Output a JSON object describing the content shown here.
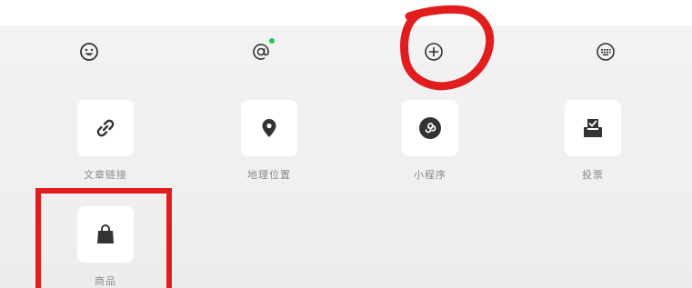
{
  "toolbar": {
    "buttons": [
      {
        "name": "emoji",
        "icon": "smiley-face-icon"
      },
      {
        "name": "mention",
        "icon": "at-sign-icon",
        "badge_color": "#22c55e"
      },
      {
        "name": "add",
        "icon": "plus-circle-icon"
      },
      {
        "name": "keyboard",
        "icon": "keyboard-icon"
      }
    ]
  },
  "tools": [
    {
      "label": "文章链接",
      "icon": "link-icon"
    },
    {
      "label": "地理位置",
      "icon": "location-pin-icon"
    },
    {
      "label": "小程序",
      "icon": "mini-program-icon"
    },
    {
      "label": "投票",
      "icon": "vote-box-icon"
    },
    {
      "label": "商品",
      "icon": "shopping-bag-icon"
    }
  ],
  "annotations": {
    "circle_color": "#e11d1d",
    "box_color": "#e11d1d"
  },
  "colors": {
    "icon": "#333333",
    "label": "#8a8a8a",
    "tile": "#ffffff",
    "panel": "#f0f0f0"
  }
}
